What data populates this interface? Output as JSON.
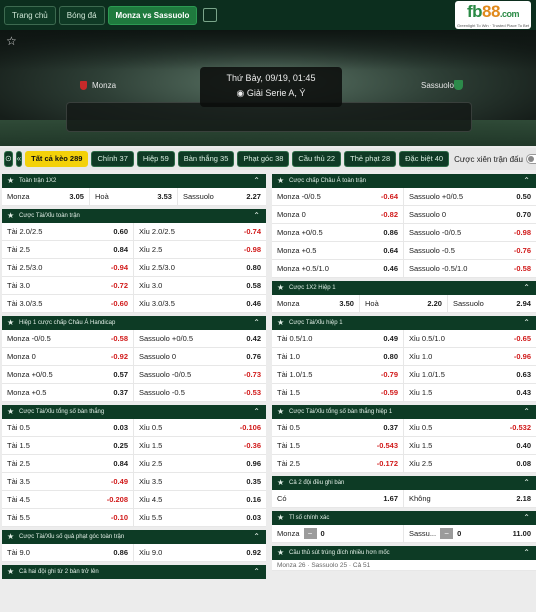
{
  "nav": {
    "home": "Trang chủ",
    "football": "Bóng đá",
    "match": "Monza vs Sassuolo"
  },
  "logo": {
    "text_a": "fb",
    "text_b": "88",
    "text_c": ".com",
    "tagline": "Greenlight To Win · Trusted Place To Bet"
  },
  "match": {
    "home": "Monza",
    "away": "Sassuolo",
    "datetime": "Thứ Bảy, 09/19, 01:45",
    "league": "Giải Serie A, Ý"
  },
  "filters": {
    "sq1": "⊙",
    "sq2": "«",
    "items": [
      "Tất cả kèo 289",
      "Chính 37",
      "Hiệp 59",
      "Bàn thắng 35",
      "Phạt góc 38",
      "Cầu thủ 22",
      "Thẻ phạt 28",
      "Đặc biệt 40"
    ],
    "toggle": "Cược xiên trận đấu"
  },
  "left": [
    {
      "title": "Toàn trận 1X2",
      "rows": [
        [
          [
            "Monza",
            "3.05"
          ],
          [
            "Hoà",
            "3.53"
          ],
          [
            "Sassuolo",
            "2.27"
          ]
        ]
      ]
    },
    {
      "title": "Cược Tài/Xỉu toàn trận",
      "rows": [
        [
          [
            "Tài 2.0/2.5",
            "0.60"
          ],
          [
            "Xỉu 2.0/2.5",
            "-0.74"
          ]
        ],
        [
          [
            "Tài 2.5",
            "0.84"
          ],
          [
            "Xỉu 2.5",
            "-0.98"
          ]
        ],
        [
          [
            "Tài 2.5/3.0",
            "-0.94"
          ],
          [
            "Xỉu 2.5/3.0",
            "0.80"
          ]
        ],
        [
          [
            "Tài 3.0",
            "-0.72"
          ],
          [
            "Xỉu 3.0",
            "0.58"
          ]
        ],
        [
          [
            "Tài 3.0/3.5",
            "-0.60"
          ],
          [
            "Xỉu 3.0/3.5",
            "0.46"
          ]
        ]
      ]
    },
    {
      "title": "Hiệp 1 cược chấp Châu Á Handicap",
      "rows": [
        [
          [
            "Monza -0/0.5",
            "-0.58"
          ],
          [
            "Sassuolo +0/0.5",
            "0.42"
          ]
        ],
        [
          [
            "Monza 0",
            "-0.92"
          ],
          [
            "Sassuolo 0",
            "0.76"
          ]
        ],
        [
          [
            "Monza +0/0.5",
            "0.57"
          ],
          [
            "Sassuolo -0/0.5",
            "-0.73"
          ]
        ],
        [
          [
            "Monza +0.5",
            "0.37"
          ],
          [
            "Sassuolo -0.5",
            "-0.53"
          ]
        ]
      ]
    },
    {
      "title": "Cược Tài/Xỉu tổng số bàn thắng",
      "rows": [
        [
          [
            "Tài 0.5",
            "0.03"
          ],
          [
            "Xỉu 0.5",
            "-0.106"
          ]
        ],
        [
          [
            "Tài 1.5",
            "0.25"
          ],
          [
            "Xỉu 1.5",
            "-0.36"
          ]
        ],
        [
          [
            "Tài 2.5",
            "0.84"
          ],
          [
            "Xỉu 2.5",
            "0.96"
          ]
        ],
        [
          [
            "Tài 3.5",
            "-0.49"
          ],
          [
            "Xỉu 3.5",
            "0.35"
          ]
        ],
        [
          [
            "Tài 4.5",
            "-0.208"
          ],
          [
            "Xỉu 4.5",
            "0.16"
          ]
        ],
        [
          [
            "Tài 5.5",
            "-0.10"
          ],
          [
            "Xỉu 5.5",
            "0.03"
          ]
        ]
      ]
    },
    {
      "title": "Cược Tài/Xỉu số quả phạt góc toàn trận",
      "rows": [
        [
          [
            "Tài 9.0",
            "0.86"
          ],
          [
            "Xỉu 9.0",
            "0.92"
          ]
        ]
      ]
    },
    {
      "title": "Cả hai đội ghi từ 2 bàn trở lên",
      "rows": []
    }
  ],
  "right": [
    {
      "title": "Cược chấp Châu Á toàn trận",
      "rows": [
        [
          [
            "Monza -0/0.5",
            "-0.64"
          ],
          [
            "Sassuolo +0/0.5",
            "0.50"
          ]
        ],
        [
          [
            "Monza 0",
            "-0.82"
          ],
          [
            "Sassuolo 0",
            "0.70"
          ]
        ],
        [
          [
            "Monza +0/0.5",
            "0.86"
          ],
          [
            "Sassuolo -0/0.5",
            "-0.98"
          ]
        ],
        [
          [
            "Monza +0.5",
            "0.64"
          ],
          [
            "Sassuolo -0.5",
            "-0.76"
          ]
        ],
        [
          [
            "Monza +0.5/1.0",
            "0.46"
          ],
          [
            "Sassuolo -0.5/1.0",
            "-0.58"
          ]
        ]
      ]
    },
    {
      "title": "Cược 1X2 Hiệp 1",
      "rows": [
        [
          [
            "Monza",
            "3.50"
          ],
          [
            "Hoà",
            "2.20"
          ],
          [
            "Sassuolo",
            "2.94"
          ]
        ]
      ]
    },
    {
      "title": "Cược Tài/Xỉu hiệp 1",
      "rows": [
        [
          [
            "Tài 0.5/1.0",
            "0.49"
          ],
          [
            "Xỉu 0.5/1.0",
            "-0.65"
          ]
        ],
        [
          [
            "Tài 1.0",
            "0.80"
          ],
          [
            "Xỉu 1.0",
            "-0.96"
          ]
        ],
        [
          [
            "Tài 1.0/1.5",
            "-0.79"
          ],
          [
            "Xỉu 1.0/1.5",
            "0.63"
          ]
        ],
        [
          [
            "Tài 1.5",
            "-0.59"
          ],
          [
            "Xỉu 1.5",
            "0.43"
          ]
        ]
      ]
    },
    {
      "title": "Cược Tài/Xỉu tổng số bàn thắng hiệp 1",
      "rows": [
        [
          [
            "Tài 0.5",
            "0.37"
          ],
          [
            "Xỉu 0.5",
            "-0.532"
          ]
        ],
        [
          [
            "Tài 1.5",
            "-0.543"
          ],
          [
            "Xỉu 1.5",
            "0.40"
          ]
        ],
        [
          [
            "Tài 2.5",
            "-0.172"
          ],
          [
            "Xỉu 2.5",
            "0.08"
          ]
        ]
      ]
    },
    {
      "title": "Cả 2 đội đều ghi bàn",
      "rows": [
        [
          [
            "Có",
            "1.67"
          ],
          [
            "Không",
            "2.18"
          ]
        ]
      ]
    },
    {
      "title": "Tỉ số chính xác",
      "score": {
        "home": "Monza",
        "away": "Sassu...",
        "hs": "0",
        "as": "0",
        "odds": "11.00"
      }
    },
    {
      "title": "Cầu thủ sút trúng đích nhiều hơn mốc",
      "teaser": "Monza 26 · Sassuolo 25 · Cả 51"
    }
  ]
}
